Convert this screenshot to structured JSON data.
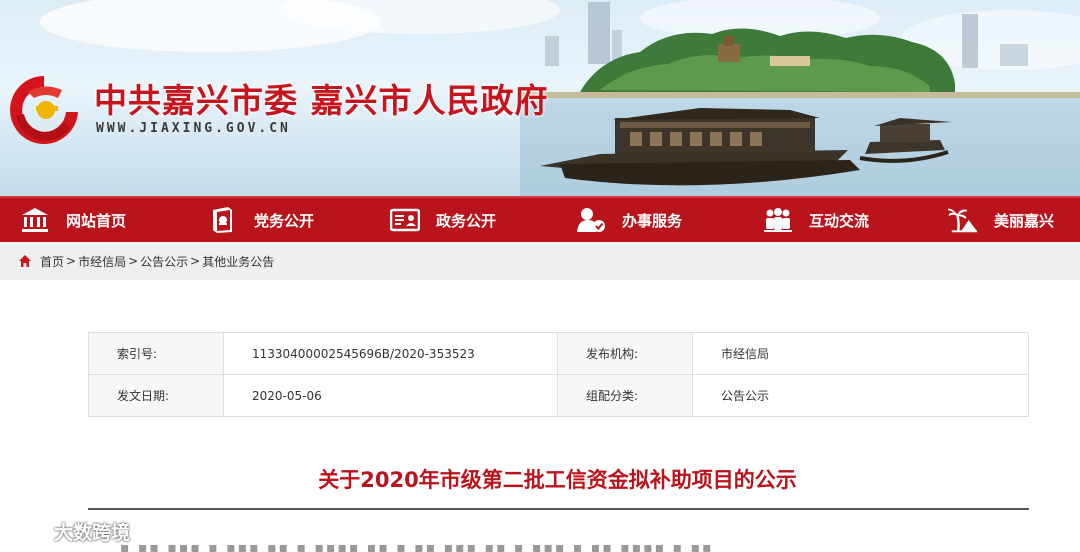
{
  "header": {
    "site_title": "中共嘉兴市委  嘉兴市人民政府",
    "site_url": "WWW.JIAXING.GOV.CN",
    "brand_color": "#c5161d"
  },
  "nav": {
    "items": [
      {
        "label": "网站首页",
        "icon": "museum-icon"
      },
      {
        "label": "党务公开",
        "icon": "party-book-icon"
      },
      {
        "label": "政务公开",
        "icon": "government-card-icon"
      },
      {
        "label": "办事服务",
        "icon": "service-user-icon"
      },
      {
        "label": "互动交流",
        "icon": "people-group-icon"
      },
      {
        "label": "美丽嘉兴",
        "icon": "palm-tree-icon"
      }
    ],
    "bg_color": "#b9141b"
  },
  "breadcrumb": {
    "items": [
      "首页",
      "市经信局",
      "公告公示",
      "其他业务公告"
    ],
    "separator": ">"
  },
  "meta": {
    "index_label": "索引号:",
    "index_value": "11330400002545696B/2020-353523",
    "org_label": "发布机构:",
    "org_value": "市经信局",
    "date_label": "发文日期:",
    "date_value": "2020-05-06",
    "category_label": "组配分类:",
    "category_value": "公告公示"
  },
  "article": {
    "title": "关于2020年市级第二批工信资金拟补助项目的公示"
  },
  "watermark": {
    "text": "大数跨境"
  }
}
